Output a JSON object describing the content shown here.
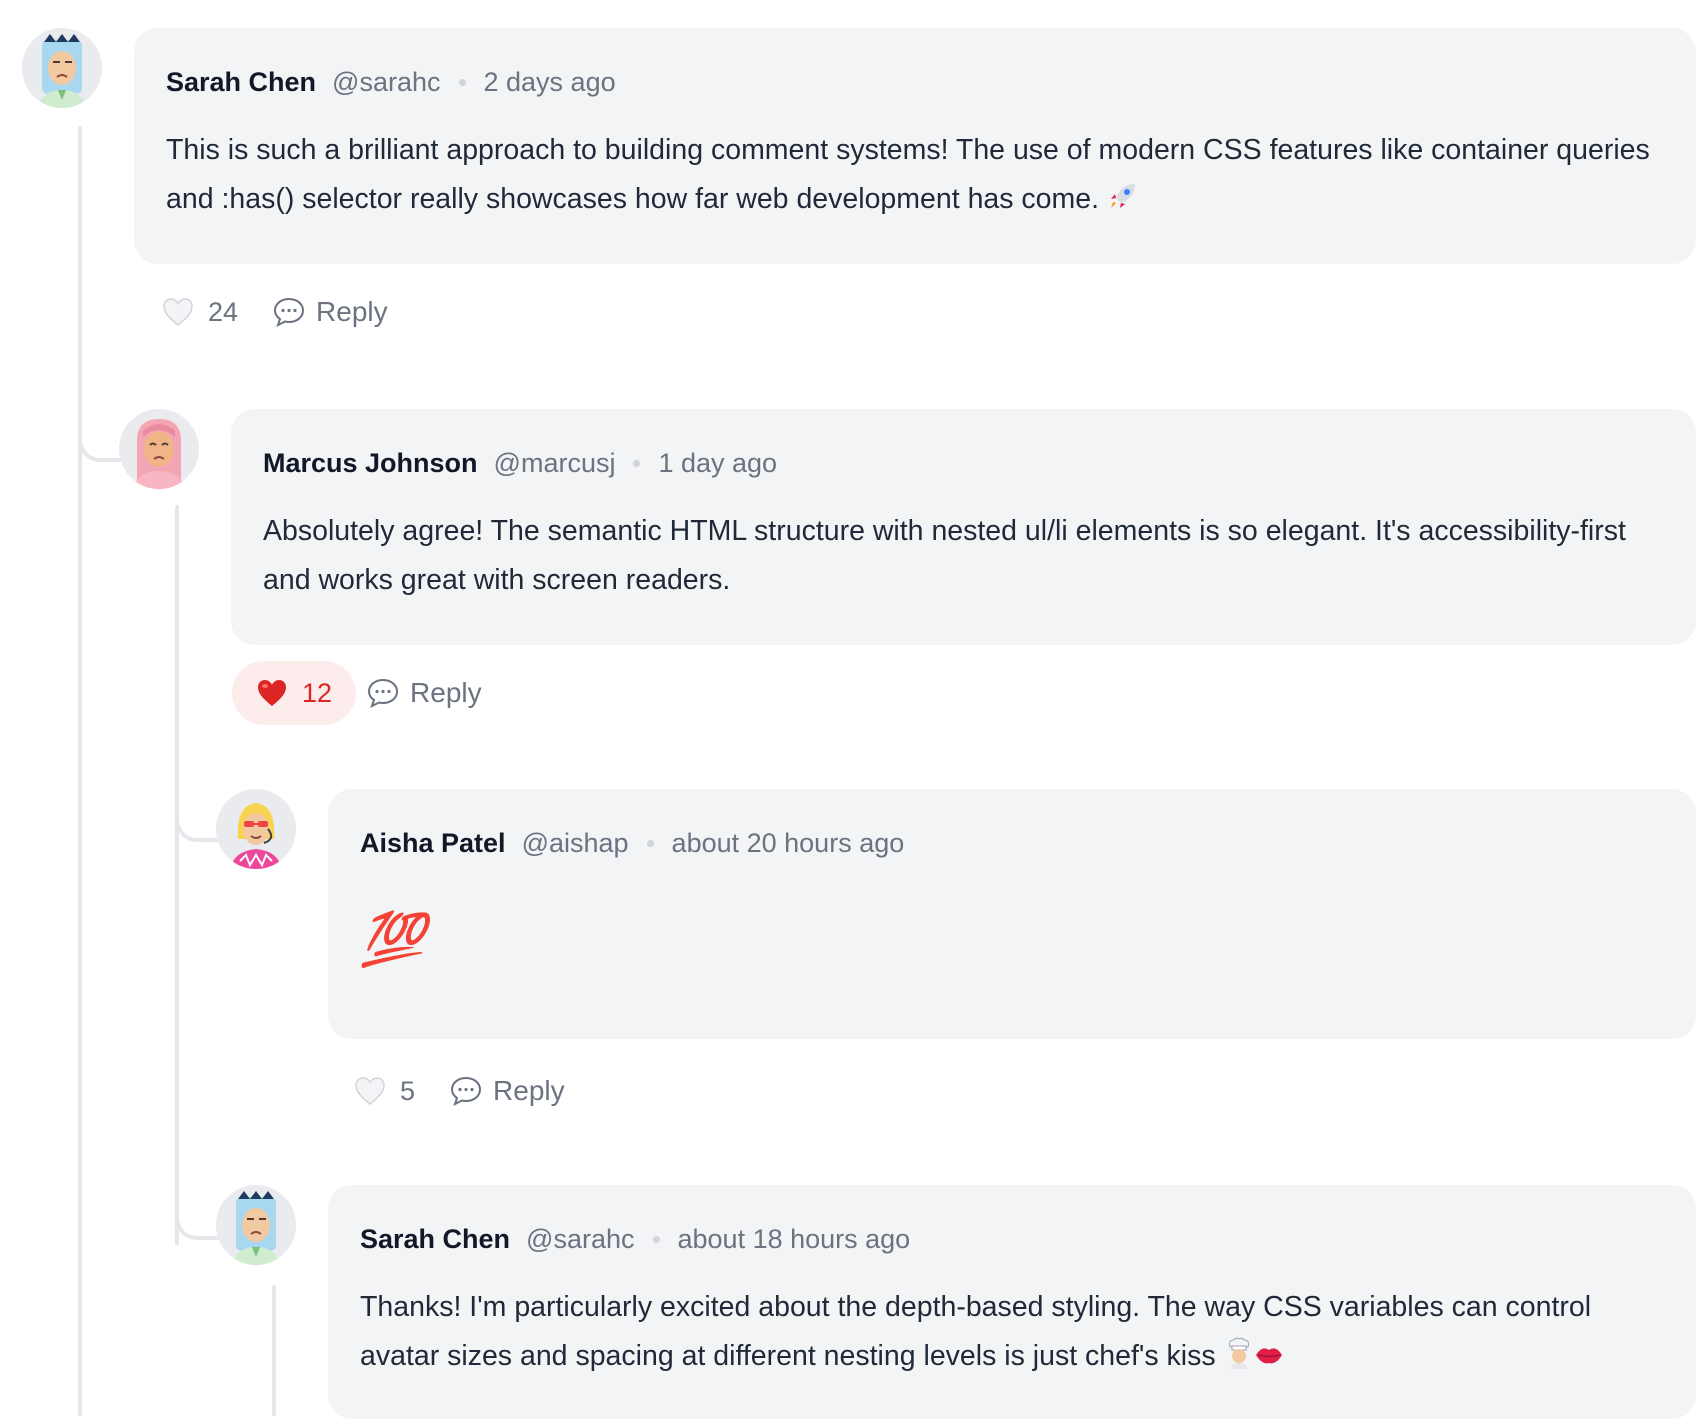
{
  "colors": {
    "bubble_bg": "#f3f4f6",
    "thread_line": "#e5e7eb",
    "liked_red": "#dc2626",
    "liked_bg": "#fdecec",
    "muted_text": "#6b7280"
  },
  "comments": [
    {
      "author": "Sarah Chen",
      "handle": "@sarahc",
      "time": "2 days ago",
      "text": "This is such a brilliant approach to building comment systems! The use of modern CSS features like container queries and :has() selector really showcases how far web development has come.",
      "text_emoji": "rocket-emoji",
      "likes": "24",
      "liked": false,
      "reply_label": "Reply",
      "avatar": "sarah-avatar-icon"
    },
    {
      "author": "Marcus Johnson",
      "handle": "@marcusj",
      "time": "1 day ago",
      "text": "Absolutely agree! The semantic HTML structure with nested ul/li elements is so elegant. It's accessibility-first and works great with screen readers.",
      "likes": "12",
      "liked": true,
      "reply_label": "Reply",
      "avatar": "marcus-avatar-icon"
    },
    {
      "author": "Aisha Patel",
      "handle": "@aishap",
      "time": "about 20 hours ago",
      "text": "💯",
      "likes": "5",
      "liked": false,
      "reply_label": "Reply",
      "avatar": "aisha-avatar-icon"
    },
    {
      "author": "Sarah Chen",
      "handle": "@sarahc",
      "time": "about 18 hours ago",
      "text": "Thanks! I'm particularly excited about the depth-based styling. The way CSS variables can control avatar sizes and spacing at different nesting levels is just chef's kiss",
      "text_emoji": "chef-kiss-emoji",
      "avatar": "sarah-avatar-icon"
    }
  ]
}
